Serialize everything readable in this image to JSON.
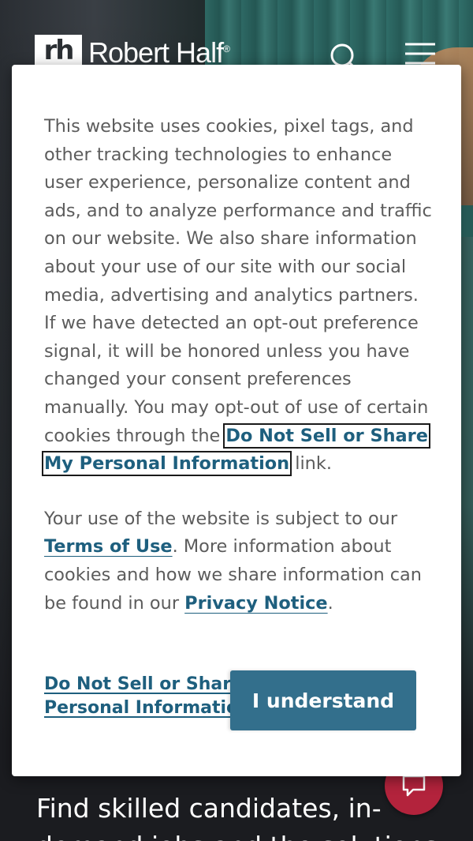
{
  "header": {
    "logo_mark": "rh",
    "logo_text": "Robert Half",
    "logo_reg": "®"
  },
  "background": {
    "headline": "Find skilled candidates, in-demand jobs and the solutions"
  },
  "cookie_dialog": {
    "para1_intro": "This website uses cookies, pixel tags, and other tracking technologies to enhance user experience, personalize content and ads, and to analyze performance and traffic on our website. We also share information about your use of our site with our social media, advertising and analytics partners. If we have detected an opt-out preference signal, it will be honored unless you have changed your consent preferences manually. You may opt-out of use of certain cookies through the ",
    "para1_link": "Do Not Sell or Share My Personal Information",
    "para1_end": " link.",
    "para2_intro": "Your use of the website is subject to our ",
    "terms_link": "Terms of Use",
    "para2_mid": ". More information about cookies and how we share information can be found in our ",
    "privacy_link": "Privacy Notice",
    "para2_end": ".",
    "footer_link": "Do Not Sell or Share My Personal Information",
    "accept_label": "I understand"
  },
  "colors": {
    "link": "#1e5f7e",
    "button": "#336f8c",
    "chat": "#b3233c"
  },
  "icons": {
    "search": "search-icon",
    "menu": "hamburger-menu-icon",
    "chat": "chat-icon"
  }
}
